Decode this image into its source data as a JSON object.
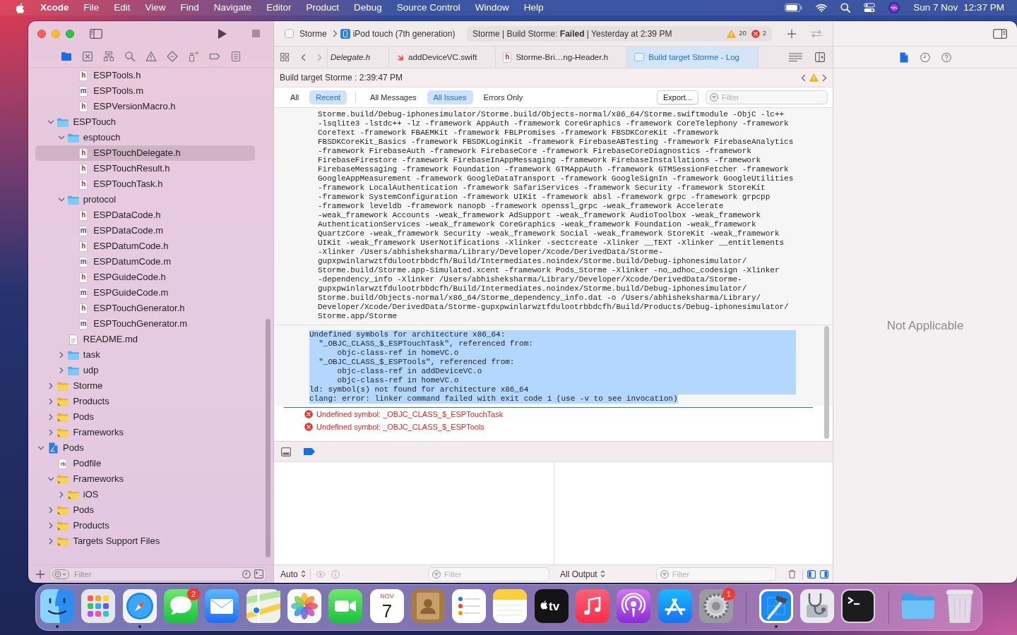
{
  "menu_bar": {
    "app_menu": "Xcode",
    "menus": [
      "File",
      "Edit",
      "View",
      "Find",
      "Navigate",
      "Editor",
      "Product",
      "Debug",
      "Source Control",
      "Window",
      "Help"
    ],
    "date": "Sun 7 Nov",
    "time": "12:37 PM"
  },
  "toolbar": {
    "scheme": "Storme",
    "destination": "iPod touch (7th generation)",
    "activity": "Storme | Build Storme: **Failed** | Yesterday at 2:39 PM",
    "warning_count": "20",
    "error_count": "2"
  },
  "navigator": {
    "tabs": [
      {
        "kind": "project",
        "selected": true
      },
      {
        "kind": "source-control",
        "selected": false
      },
      {
        "kind": "symbol",
        "selected": false
      },
      {
        "kind": "find",
        "selected": false
      },
      {
        "kind": "issue",
        "selected": false
      },
      {
        "kind": "test",
        "selected": false
      },
      {
        "kind": "debug",
        "selected": false
      },
      {
        "kind": "breakpoint",
        "selected": false
      },
      {
        "kind": "report",
        "selected": false
      }
    ],
    "tree": [
      {
        "children": [
          {
            "children": [
              {
                "children": [
                  {
                    "label": "ESPTools.h",
                    "kind": "header",
                    "glyph": "h",
                    "selected": false
                  },
                  {
                    "label": "ESPTools.m",
                    "kind": "source",
                    "glyph": "m",
                    "selected": false
                  },
                  {
                    "label": "ESPVersionMacro.h",
                    "kind": "header",
                    "glyph": "h",
                    "selected": false
                  }
                ]
              }
            ]
          },
          {
            "label": "ESPTouch",
            "kind": "folder",
            "expanded": true,
            "selected": false,
            "children": [
              {
                "label": "esptouch",
                "kind": "folder",
                "expanded": true,
                "selected": false,
                "children": [
                  {
                    "label": "ESPTouchDelegate.h",
                    "kind": "header",
                    "glyph": "h",
                    "selected": true
                  },
                  {
                    "label": "ESPTouchResult.h",
                    "kind": "header",
                    "glyph": "h",
                    "selected": false
                  },
                  {
                    "label": "ESPTouchTask.h",
                    "kind": "header",
                    "glyph": "h",
                    "selected": false
                  }
                ]
              },
              {
                "label": "protocol",
                "kind": "folder",
                "expanded": true,
                "selected": false,
                "children": [
                  {
                    "label": "ESPDataCode.h",
                    "kind": "header",
                    "glyph": "h",
                    "selected": false
                  },
                  {
                    "label": "ESPDataCode.m",
                    "kind": "source",
                    "glyph": "m",
                    "selected": false
                  },
                  {
                    "label": "ESPDatumCode.h",
                    "kind": "header",
                    "glyph": "h",
                    "selected": false
                  },
                  {
                    "label": "ESPDatumCode.m",
                    "kind": "source",
                    "glyph": "m",
                    "selected": false
                  },
                  {
                    "label": "ESPGuideCode.h",
                    "kind": "header",
                    "glyph": "h",
                    "selected": false
                  },
                  {
                    "label": "ESPGuideCode.m",
                    "kind": "source",
                    "glyph": "m",
                    "selected": false
                  },
                  {
                    "label": "ESPTouchGenerator.h",
                    "kind": "header",
                    "glyph": "h",
                    "selected": false
                  },
                  {
                    "label": "ESPTouchGenerator.m",
                    "kind": "source",
                    "glyph": "m",
                    "selected": false
                  }
                ]
              },
              {
                "label": "README.md",
                "kind": "text",
                "selected": false
              },
              {
                "label": "task",
                "kind": "folder",
                "expanded": false,
                "selected": false
              },
              {
                "label": "udp",
                "kind": "folder",
                "expanded": false,
                "selected": false
              }
            ]
          },
          {
            "label": "Storme",
            "kind": "group",
            "expanded": false,
            "selected": false
          },
          {
            "label": "Products",
            "kind": "linked-group",
            "expanded": false,
            "selected": false
          },
          {
            "label": "Pods",
            "kind": "linked-group",
            "expanded": false,
            "selected": false
          },
          {
            "label": "Frameworks",
            "kind": "linked-group",
            "expanded": false,
            "selected": false
          }
        ]
      },
      {
        "label": "Pods",
        "kind": "project",
        "expanded": true,
        "selected": false,
        "children": [
          {
            "label": "Podfile",
            "kind": "ruby",
            "glyph": "rb",
            "selected": false
          },
          {
            "label": "Frameworks",
            "kind": "linked-group",
            "expanded": true,
            "selected": false,
            "children": [
              {
                "label": "iOS",
                "kind": "linked-group",
                "expanded": false,
                "selected": false
              }
            ]
          },
          {
            "label": "Pods",
            "kind": "linked-group",
            "expanded": false,
            "selected": false
          },
          {
            "label": "Products",
            "kind": "linked-group",
            "expanded": false,
            "selected": false
          },
          {
            "label": "Targets Support Files",
            "kind": "linked-group",
            "expanded": false,
            "selected": false
          }
        ]
      }
    ],
    "filter_placeholder": "Filter"
  },
  "editor_tabs": [
    {
      "label": "Delegate.h",
      "kind": "clipped",
      "preview": true,
      "selected": false
    },
    {
      "label": "addDeviceVC.swift",
      "kind": "swift",
      "preview": false,
      "selected": false
    },
    {
      "label": "Storme-Bri…ng-Header.h",
      "kind": "header",
      "glyph": "h",
      "preview": false,
      "selected": false
    },
    {
      "label": "Build target Storme - Log",
      "kind": "log",
      "preview": false,
      "selected": true
    }
  ],
  "build_log": {
    "title": "Build target Storme : 2:39:47 PM",
    "scope_filters": [
      {
        "label": "All",
        "selected": false
      },
      {
        "label": "Recent",
        "selected": true
      }
    ],
    "message_filters": [
      {
        "label": "All Messages",
        "selected": false
      },
      {
        "label": "All Issues",
        "selected": true
      },
      {
        "label": "Errors Only",
        "selected": false
      }
    ],
    "export_button": "Export...",
    "filter_placeholder": "Filter",
    "transcript": [
      "Storme.build/Debug-iphonesimulator/Storme.build/Objects-normal/x86_64/Storme.swiftmodule -ObjC -lc++",
      "-lsqlite3 -lstdc++ -lz -framework AppAuth -framework CoreGraphics -framework CoreTelephony -framework",
      "CoreText -framework FBAEMKit -framework FBLPromises -framework FBSDKCoreKit -framework",
      "FBSDKCoreKit_Basics -framework FBSDKLoginKit -framework FirebaseABTesting -framework FirebaseAnalytics",
      "-framework FirebaseAuth -framework FirebaseCore -framework FirebaseCoreDiagnostics -framework",
      "FirebaseFirestore -framework FirebaseInAppMessaging -framework FirebaseInstallations -framework",
      "FirebaseMessaging -framework Foundation -framework GTMAppAuth -framework GTMSessionFetcher -framework",
      "GoogleAppMeasurement -framework GoogleDataTransport -framework GoogleSignIn -framework GoogleUtilities",
      "-framework LocalAuthentication -framework SafariServices -framework Security -framework StoreKit",
      "-framework SystemConfiguration -framework UIKit -framework absl -framework grpc -framework grpcpp",
      "-framework leveldb -framework nanopb -framework openssl_grpc -weak_framework Accelerate",
      "-weak_framework Accounts -weak_framework AdSupport -weak_framework AudioToolbox -weak_framework",
      "AuthenticationServices -weak_framework CoreGraphics -weak_framework Foundation -weak_framework",
      "QuartzCore -weak_framework Security -weak_framework Social -weak_framework StoreKit -weak_framework",
      "UIKit -weak_framework UserNotifications -Xlinker -sectcreate -Xlinker __TEXT -Xlinker __entitlements",
      "-Xlinker /Users/abhisheksharma/Library/Developer/Xcode/DerivedData/Storme-",
      "gupxpwinlarwztfdulootrbbdcfh/Build/Intermediates.noindex/Storme.build/Debug-iphonesimulator/",
      "Storme.build/Storme.app-Simulated.xcent -framework Pods_Storme -Xlinker -no_adhoc_codesign -Xlinker",
      "-dependency_info -Xlinker /Users/abhisheksharma/Library/Developer/Xcode/DerivedData/Storme-",
      "gupxpwinlarwztfdulootrbbdcfh/Build/Intermediates.noindex/Storme.build/Debug-iphonesimulator/",
      "Storme.build/Objects-normal/x86_64/Storme_dependency_info.dat -o /Users/abhisheksharma/Library/",
      "Developer/Xcode/DerivedData/Storme-gupxpwinlarwztfdulootrbbdcfh/Build/Products/Debug-iphonesimulator/",
      "Storme.app/Storme"
    ],
    "linker_output": {
      "selected": true,
      "lines": [
        "Undefined symbols for architecture x86_64:",
        "  \"_OBJC_CLASS_$_ESPTouchTask\", referenced from:",
        "      objc-class-ref in homeVC.o",
        "  \"_OBJC_CLASS_$_ESPTools\", referenced from:",
        "      objc-class-ref in addDeviceVC.o",
        "      objc-class-ref in homeVC.o",
        "ld: symbol(s) not found for architecture x86_64",
        "clang: error: linker command failed with exit code 1 (use -v to see invocation)"
      ]
    },
    "issues": [
      {
        "kind": "error",
        "text": "Undefined symbol: _OBJC_CLASS_$_ESPTouchTask"
      },
      {
        "kind": "error",
        "text": "Undefined symbol: _OBJC_CLASS_$_ESPTools"
      }
    ]
  },
  "debug_area": {
    "variables_scope": "Auto",
    "variables_filter_placeholder": "Filter",
    "console_scope": "All Output",
    "console_filter_placeholder": "Filter"
  },
  "inspector": {
    "tabs": [
      {
        "kind": "file",
        "selected": true
      },
      {
        "kind": "history",
        "selected": false
      },
      {
        "kind": "help",
        "selected": false
      }
    ],
    "empty_message": "Not Applicable"
  },
  "dock": {
    "apps": [
      {
        "kind": "finder",
        "running": true
      },
      {
        "kind": "launchpad",
        "running": false
      },
      {
        "kind": "safari",
        "running": true
      },
      {
        "kind": "messages",
        "running": false,
        "badge": "2"
      },
      {
        "kind": "mail",
        "running": false
      },
      {
        "kind": "maps",
        "running": false
      },
      {
        "kind": "photos",
        "running": false
      },
      {
        "kind": "facetime",
        "running": false
      },
      {
        "kind": "calendar",
        "running": false,
        "month": "NOV",
        "day": "7"
      },
      {
        "kind": "contacts",
        "running": false
      },
      {
        "kind": "reminders",
        "running": false
      },
      {
        "kind": "notes",
        "running": false
      },
      {
        "kind": "tv",
        "running": false,
        "label": "tv"
      },
      {
        "kind": "music",
        "running": false
      },
      {
        "kind": "podcasts",
        "running": false
      },
      {
        "kind": "app-store",
        "running": false
      },
      {
        "kind": "system-preferences",
        "running": false,
        "badge": "1"
      },
      {
        "kind": "separator"
      },
      {
        "kind": "xcode",
        "running": true
      },
      {
        "kind": "disk-tool",
        "running": false
      },
      {
        "kind": "terminal",
        "running": false
      },
      {
        "kind": "separator"
      },
      {
        "kind": "downloads",
        "running": false
      },
      {
        "kind": "trash",
        "running": false
      }
    ]
  }
}
